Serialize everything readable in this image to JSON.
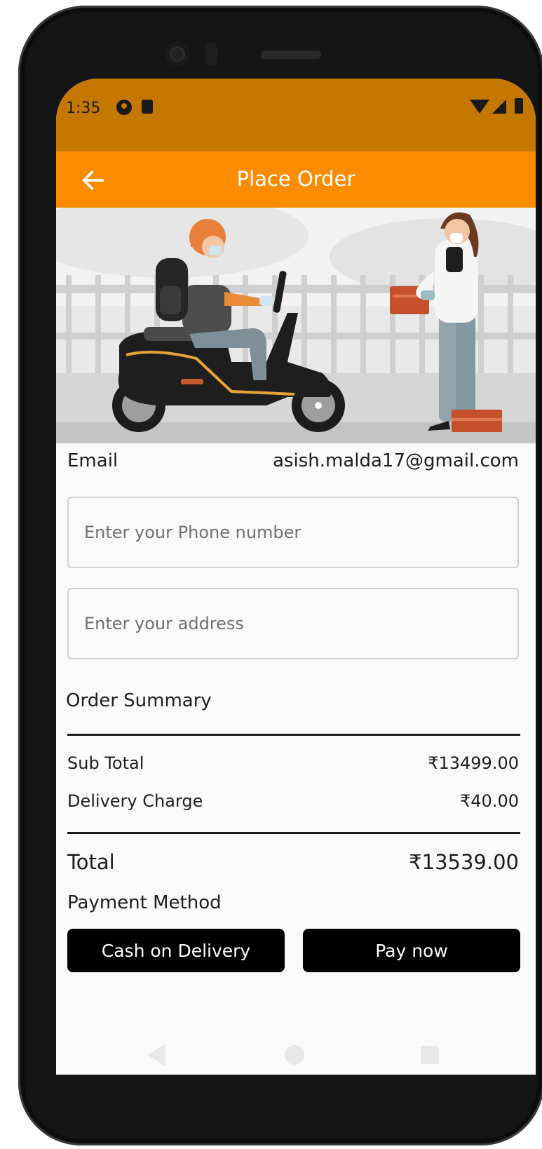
{
  "status_bar": {
    "time": "1:35"
  },
  "app_bar": {
    "title": "Place Order"
  },
  "email": {
    "label": "Email",
    "value": "asish.malda17@gmail.com"
  },
  "phone_field": {
    "placeholder": "Enter your Phone number"
  },
  "address_field": {
    "placeholder": "Enter your address"
  },
  "summary": {
    "title": "Order Summary",
    "subtotal_label": "Sub Total",
    "subtotal_value": "₹13499.00",
    "delivery_label": "Delivery Charge",
    "delivery_value": "₹40.00",
    "total_label": "Total",
    "total_value": "₹13539.00"
  },
  "payment": {
    "label": "Payment Method",
    "cod_label": "Cash on Delivery",
    "pay_now_label": "Pay now"
  },
  "colors": {
    "status_bar": "#c47800",
    "app_bar": "#fb8c00",
    "button": "#000000"
  },
  "icons": [
    "back-arrow-icon",
    "wifi-icon",
    "signal-icon",
    "battery-icon",
    "nav-back-icon",
    "nav-home-icon",
    "nav-recents-icon"
  ]
}
